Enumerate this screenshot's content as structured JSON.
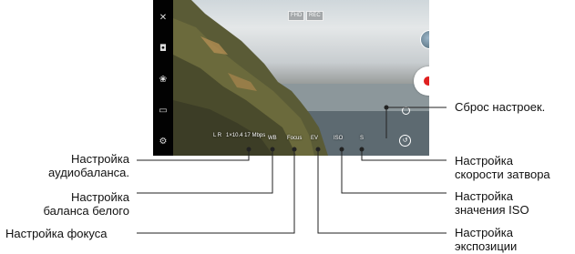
{
  "camera": {
    "top_badges": [
      "FHD",
      "",
      "REC"
    ],
    "controls": {
      "audio_label": "L\nR",
      "info_text": "1×10.4\n17 Mbps",
      "wb_label": "WB",
      "focus_label": "Focus",
      "exposure_label": "EV",
      "iso_label": "ISO",
      "shutter_label": "S"
    }
  },
  "sidebar": {
    "icons": [
      "mic-off-icon",
      "camera-switch-icon",
      "effects-icon",
      "mode-icon",
      "settings-icon"
    ]
  },
  "callouts": {
    "audio": [
      "Настройка",
      "аудиобаланса."
    ],
    "white_balance": [
      "Настройка",
      "баланса белого"
    ],
    "focus": [
      "Настройка фокуса"
    ],
    "reset": [
      "Сброс настроек."
    ],
    "shutter": [
      "Настройка",
      "скорости затвора"
    ],
    "iso": [
      "Настройка",
      "значения ISO"
    ],
    "exposure": [
      "Настройка",
      "экспозиции"
    ]
  },
  "colors": {
    "record": "#e02020",
    "leader_line": "#222222"
  }
}
